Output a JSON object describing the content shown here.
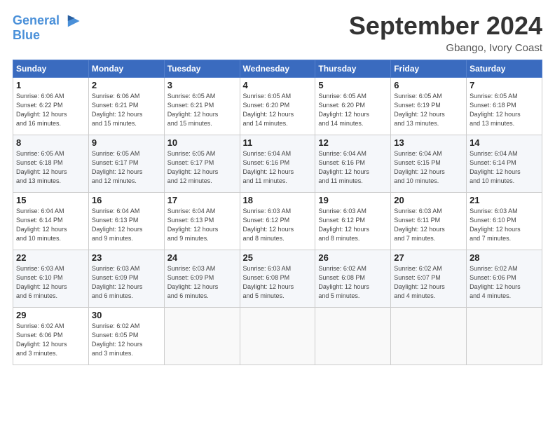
{
  "logo": {
    "line1": "General",
    "line2": "Blue"
  },
  "title": "September 2024",
  "subtitle": "Gbango, Ivory Coast",
  "weekdays": [
    "Sunday",
    "Monday",
    "Tuesday",
    "Wednesday",
    "Thursday",
    "Friday",
    "Saturday"
  ],
  "weeks": [
    [
      {
        "day": "1",
        "sunrise": "Sunrise: 6:06 AM",
        "sunset": "Sunset: 6:22 PM",
        "daylight": "Daylight: 12 hours",
        "minutes": "and 16 minutes."
      },
      {
        "day": "2",
        "sunrise": "Sunrise: 6:06 AM",
        "sunset": "Sunset: 6:21 PM",
        "daylight": "Daylight: 12 hours",
        "minutes": "and 15 minutes."
      },
      {
        "day": "3",
        "sunrise": "Sunrise: 6:05 AM",
        "sunset": "Sunset: 6:21 PM",
        "daylight": "Daylight: 12 hours",
        "minutes": "and 15 minutes."
      },
      {
        "day": "4",
        "sunrise": "Sunrise: 6:05 AM",
        "sunset": "Sunset: 6:20 PM",
        "daylight": "Daylight: 12 hours",
        "minutes": "and 14 minutes."
      },
      {
        "day": "5",
        "sunrise": "Sunrise: 6:05 AM",
        "sunset": "Sunset: 6:20 PM",
        "daylight": "Daylight: 12 hours",
        "minutes": "and 14 minutes."
      },
      {
        "day": "6",
        "sunrise": "Sunrise: 6:05 AM",
        "sunset": "Sunset: 6:19 PM",
        "daylight": "Daylight: 12 hours",
        "minutes": "and 13 minutes."
      },
      {
        "day": "7",
        "sunrise": "Sunrise: 6:05 AM",
        "sunset": "Sunset: 6:18 PM",
        "daylight": "Daylight: 12 hours",
        "minutes": "and 13 minutes."
      }
    ],
    [
      {
        "day": "8",
        "sunrise": "Sunrise: 6:05 AM",
        "sunset": "Sunset: 6:18 PM",
        "daylight": "Daylight: 12 hours",
        "minutes": "and 13 minutes."
      },
      {
        "day": "9",
        "sunrise": "Sunrise: 6:05 AM",
        "sunset": "Sunset: 6:17 PM",
        "daylight": "Daylight: 12 hours",
        "minutes": "and 12 minutes."
      },
      {
        "day": "10",
        "sunrise": "Sunrise: 6:05 AM",
        "sunset": "Sunset: 6:17 PM",
        "daylight": "Daylight: 12 hours",
        "minutes": "and 12 minutes."
      },
      {
        "day": "11",
        "sunrise": "Sunrise: 6:04 AM",
        "sunset": "Sunset: 6:16 PM",
        "daylight": "Daylight: 12 hours",
        "minutes": "and 11 minutes."
      },
      {
        "day": "12",
        "sunrise": "Sunrise: 6:04 AM",
        "sunset": "Sunset: 6:16 PM",
        "daylight": "Daylight: 12 hours",
        "minutes": "and 11 minutes."
      },
      {
        "day": "13",
        "sunrise": "Sunrise: 6:04 AM",
        "sunset": "Sunset: 6:15 PM",
        "daylight": "Daylight: 12 hours",
        "minutes": "and 10 minutes."
      },
      {
        "day": "14",
        "sunrise": "Sunrise: 6:04 AM",
        "sunset": "Sunset: 6:14 PM",
        "daylight": "Daylight: 12 hours",
        "minutes": "and 10 minutes."
      }
    ],
    [
      {
        "day": "15",
        "sunrise": "Sunrise: 6:04 AM",
        "sunset": "Sunset: 6:14 PM",
        "daylight": "Daylight: 12 hours",
        "minutes": "and 10 minutes."
      },
      {
        "day": "16",
        "sunrise": "Sunrise: 6:04 AM",
        "sunset": "Sunset: 6:13 PM",
        "daylight": "Daylight: 12 hours",
        "minutes": "and 9 minutes."
      },
      {
        "day": "17",
        "sunrise": "Sunrise: 6:04 AM",
        "sunset": "Sunset: 6:13 PM",
        "daylight": "Daylight: 12 hours",
        "minutes": "and 9 minutes."
      },
      {
        "day": "18",
        "sunrise": "Sunrise: 6:03 AM",
        "sunset": "Sunset: 6:12 PM",
        "daylight": "Daylight: 12 hours",
        "minutes": "and 8 minutes."
      },
      {
        "day": "19",
        "sunrise": "Sunrise: 6:03 AM",
        "sunset": "Sunset: 6:12 PM",
        "daylight": "Daylight: 12 hours",
        "minutes": "and 8 minutes."
      },
      {
        "day": "20",
        "sunrise": "Sunrise: 6:03 AM",
        "sunset": "Sunset: 6:11 PM",
        "daylight": "Daylight: 12 hours",
        "minutes": "and 7 minutes."
      },
      {
        "day": "21",
        "sunrise": "Sunrise: 6:03 AM",
        "sunset": "Sunset: 6:10 PM",
        "daylight": "Daylight: 12 hours",
        "minutes": "and 7 minutes."
      }
    ],
    [
      {
        "day": "22",
        "sunrise": "Sunrise: 6:03 AM",
        "sunset": "Sunset: 6:10 PM",
        "daylight": "Daylight: 12 hours",
        "minutes": "and 6 minutes."
      },
      {
        "day": "23",
        "sunrise": "Sunrise: 6:03 AM",
        "sunset": "Sunset: 6:09 PM",
        "daylight": "Daylight: 12 hours",
        "minutes": "and 6 minutes."
      },
      {
        "day": "24",
        "sunrise": "Sunrise: 6:03 AM",
        "sunset": "Sunset: 6:09 PM",
        "daylight": "Daylight: 12 hours",
        "minutes": "and 6 minutes."
      },
      {
        "day": "25",
        "sunrise": "Sunrise: 6:03 AM",
        "sunset": "Sunset: 6:08 PM",
        "daylight": "Daylight: 12 hours",
        "minutes": "and 5 minutes."
      },
      {
        "day": "26",
        "sunrise": "Sunrise: 6:02 AM",
        "sunset": "Sunset: 6:08 PM",
        "daylight": "Daylight: 12 hours",
        "minutes": "and 5 minutes."
      },
      {
        "day": "27",
        "sunrise": "Sunrise: 6:02 AM",
        "sunset": "Sunset: 6:07 PM",
        "daylight": "Daylight: 12 hours",
        "minutes": "and 4 minutes."
      },
      {
        "day": "28",
        "sunrise": "Sunrise: 6:02 AM",
        "sunset": "Sunset: 6:06 PM",
        "daylight": "Daylight: 12 hours",
        "minutes": "and 4 minutes."
      }
    ],
    [
      {
        "day": "29",
        "sunrise": "Sunrise: 6:02 AM",
        "sunset": "Sunset: 6:06 PM",
        "daylight": "Daylight: 12 hours",
        "minutes": "and 3 minutes."
      },
      {
        "day": "30",
        "sunrise": "Sunrise: 6:02 AM",
        "sunset": "Sunset: 6:05 PM",
        "daylight": "Daylight: 12 hours",
        "minutes": "and 3 minutes."
      },
      null,
      null,
      null,
      null,
      null
    ]
  ]
}
